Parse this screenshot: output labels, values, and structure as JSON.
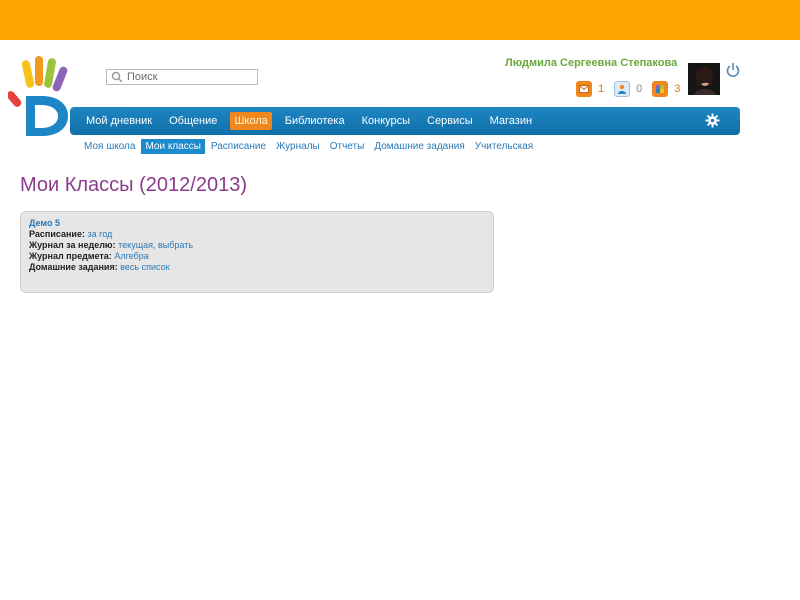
{
  "search": {
    "placeholder": "Поиск"
  },
  "user": {
    "name": "Людмила Сергеевна Степакова",
    "badges": [
      {
        "icon": "mail-icon",
        "count": "1",
        "color": "#f0861e"
      },
      {
        "icon": "person-icon",
        "count": "0",
        "color": "#9fc0e0"
      },
      {
        "icon": "puzzle-icon",
        "count": "3",
        "color": "#f0861e"
      }
    ]
  },
  "nav": {
    "items": [
      "Мой дневник",
      "Общение",
      "Школа",
      "Библиотека",
      "Конкурсы",
      "Сервисы",
      "Магазин"
    ],
    "active_index": 2
  },
  "subnav": {
    "items": [
      "Моя школа",
      "Мои классы",
      "Расписание",
      "Журналы",
      "Отчеты",
      "Домашние задания",
      "Учительская"
    ],
    "active_index": 1
  },
  "page": {
    "title": "Мои Классы (2012/2013)"
  },
  "class_card": {
    "name": "Демо 5",
    "rows": [
      {
        "label": "Расписание:",
        "links": "за год"
      },
      {
        "label": "Журнал за неделю:",
        "links": "текущая, выбрать"
      },
      {
        "label": "Журнал предмета:",
        "links": "Алгебра"
      },
      {
        "label": "Домашние задания:",
        "links": "весь список"
      }
    ]
  },
  "colors": {
    "top_band": "#FFA500",
    "nav_bar": "#1279b8",
    "nav_active": "#f0861e",
    "subnav_active": "#1c8bcb",
    "title": "#8a3c8a",
    "user_name": "#6aa83a",
    "link": "#2a7ab8"
  }
}
